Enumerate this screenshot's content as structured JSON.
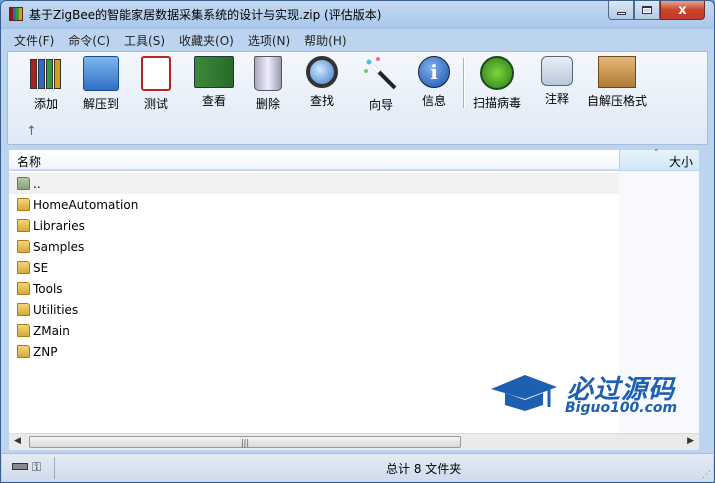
{
  "window": {
    "title": "基于ZigBee的智能家居数据采集系统的设计与实现.zip (评估版本)",
    "close_glyph": "x"
  },
  "menu": [
    "文件(F)",
    "命令(C)",
    "工具(S)",
    "收藏夹(O)",
    "选项(N)",
    "帮助(H)"
  ],
  "toolbar": {
    "buttons": [
      {
        "label": "添加",
        "icon": "add-archive-icon"
      },
      {
        "label": "解压到",
        "icon": "extract-folder-icon"
      },
      {
        "label": "测试",
        "icon": "test-clipboard-icon"
      },
      {
        "label": "查看",
        "icon": "view-book-icon"
      },
      {
        "label": "删除",
        "icon": "trash-icon"
      },
      {
        "label": "查找",
        "icon": "magnifier-icon"
      },
      {
        "label": "向导",
        "icon": "wizard-wand-icon"
      },
      {
        "label": "信息",
        "icon": "info-icon"
      },
      {
        "label": "扫描病毒",
        "icon": "virus-scan-icon"
      },
      {
        "label": "注释",
        "icon": "comment-icon"
      },
      {
        "label": "自解压格式",
        "icon": "sfx-box-icon"
      }
    ],
    "up_glyph": "↑"
  },
  "columns": {
    "name": "名称",
    "size": "大小",
    "sort_glyph": "˄"
  },
  "rows": [
    "..",
    "HomeAutomation",
    "Libraries",
    "Samples",
    "SE",
    "Tools",
    "Utilities",
    "ZMain",
    "ZNP"
  ],
  "watermark": {
    "title": "必过源码",
    "subtitle": "Biguo100.com"
  },
  "scrollbar": {
    "left": "◀",
    "right": "▶",
    "grip": "|||"
  },
  "statusbar": {
    "text": "总计 8 文件夹",
    "key_glyph": "⚿",
    "grip_glyph": "⋰"
  }
}
